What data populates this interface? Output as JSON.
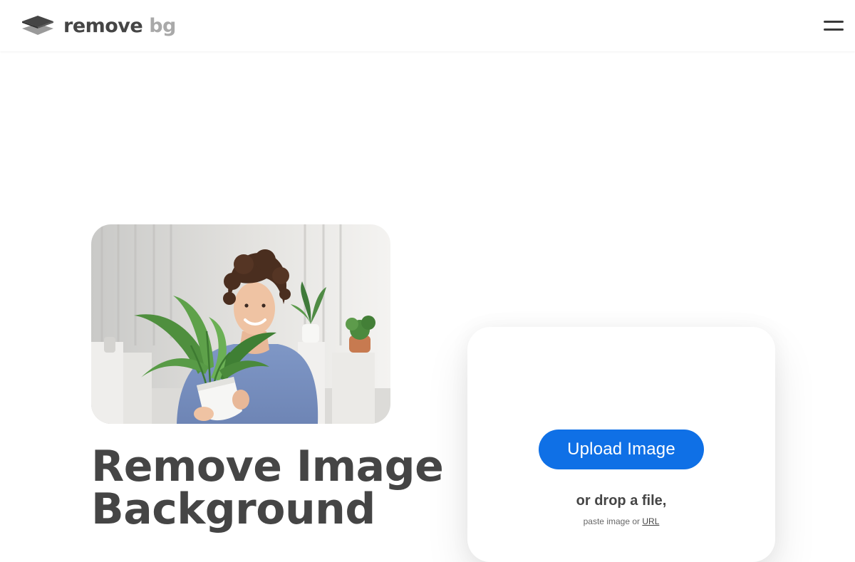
{
  "header": {
    "logo": {
      "word1": "remove",
      "word2": "bg",
      "brand_dark": "#454545",
      "brand_light": "#a9a9a9",
      "icon": "layers-logo-icon"
    },
    "menu": {
      "icon": "hamburger-menu-icon",
      "label": "Menu"
    }
  },
  "hero": {
    "image_alt": "Man holding a potted plant",
    "title_line1": "Remove Image",
    "title_line2": "Background"
  },
  "upload": {
    "button_label": "Upload Image",
    "drop_text": "or drop a file,",
    "paste_prefix": "paste image or",
    "url_link": "URL",
    "accent_color": "#0f70e6"
  }
}
